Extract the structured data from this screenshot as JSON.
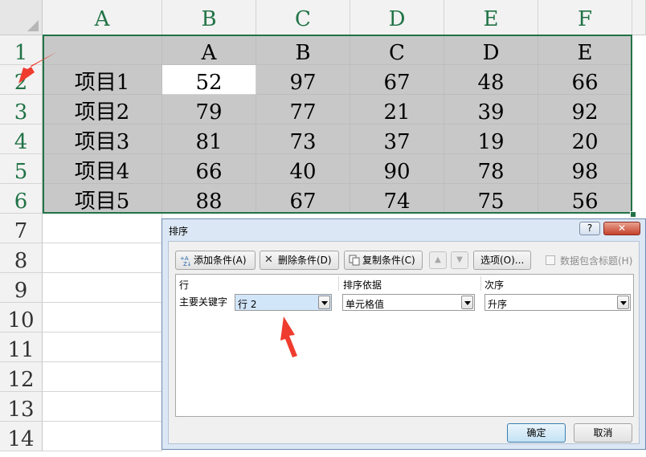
{
  "sheet": {
    "columns": [
      "A",
      "B",
      "C",
      "D",
      "E",
      "F"
    ],
    "rows": [
      "1",
      "2",
      "3",
      "4",
      "5",
      "6",
      "7",
      "8",
      "9",
      "10",
      "11",
      "12",
      "13",
      "14"
    ],
    "header_row": [
      "",
      "A",
      "B",
      "C",
      "D",
      "E"
    ],
    "data_rows": [
      [
        "项目1",
        "52",
        "97",
        "67",
        "48",
        "66"
      ],
      [
        "项目2",
        "79",
        "77",
        "21",
        "39",
        "92"
      ],
      [
        "项目3",
        "81",
        "73",
        "37",
        "19",
        "20"
      ],
      [
        "项目4",
        "66",
        "40",
        "90",
        "78",
        "98"
      ],
      [
        "项目5",
        "88",
        "67",
        "74",
        "75",
        "56"
      ]
    ],
    "header_color": "#217346",
    "selection_color": "#c8c8c8"
  },
  "dialog": {
    "title": "排序",
    "help_label": "?",
    "close_label": "✕",
    "toolbar": {
      "add_label": "添加条件(A)",
      "delete_label": "删除条件(D)",
      "copy_label": "复制条件(C)",
      "up_label": "▲",
      "down_label": "▼",
      "options_label": "选项(O)...",
      "has_headers_label": "数据包含标题(H)"
    },
    "columns": {
      "key": "行",
      "sort_on": "排序依据",
      "order": "次序"
    },
    "rule": {
      "label": "主要关键字",
      "key_value": "行 2",
      "sort_on_value": "单元格值",
      "order_value": "升序"
    },
    "ok_label": "确定",
    "cancel_label": "取消"
  },
  "annotation_color": "#f03c2e"
}
